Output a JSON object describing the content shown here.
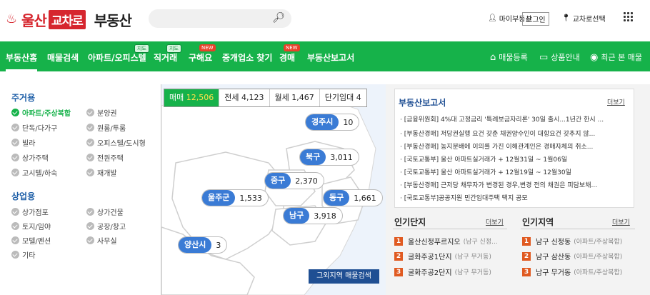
{
  "header": {
    "logo_city": "울산",
    "logo_brand": "교차로",
    "logo_suffix": "부동산",
    "mypage": "마이부동산",
    "login": "로그인",
    "region_select": "교차로선택"
  },
  "nav": {
    "tabs": [
      {
        "label": "부동산홈"
      },
      {
        "label": "매물검색"
      },
      {
        "label": "아파트/오피스텔",
        "badge": "지도"
      },
      {
        "label": "직거래",
        "badge": "지도"
      },
      {
        "label": "구해요",
        "badge": "NEW"
      },
      {
        "label": "중개업소 찾기"
      },
      {
        "label": "경매",
        "badge": "NEW"
      },
      {
        "label": "부동산보고서"
      }
    ],
    "right": [
      {
        "icon": "home-icon",
        "label": "매물등록"
      },
      {
        "icon": "monitor-icon",
        "label": "상품안내"
      },
      {
        "icon": "eye-icon",
        "label": "최근 본 매물"
      }
    ]
  },
  "filters": {
    "residential_title": "주거용",
    "residential": [
      "아파트/주상복합",
      "분양권",
      "단독/다가구",
      "원룸/투룸",
      "빌라",
      "오피스텔/도시형",
      "상가주택",
      "전원주택",
      "고시텔/하숙",
      "재개발"
    ],
    "commercial_title": "상업용",
    "commercial": [
      "상가점포",
      "상가건물",
      "토지/임야",
      "공장/창고",
      "모텔/펜션",
      "사무실",
      "기타"
    ]
  },
  "map": {
    "deal_types": [
      {
        "label": "매매",
        "count": "12,506",
        "selected": true
      },
      {
        "label": "전세",
        "count": "4,123"
      },
      {
        "label": "월세",
        "count": "1,467"
      },
      {
        "label": "단기임대",
        "count": "4"
      }
    ],
    "regions": [
      {
        "name": "경주시",
        "count": "10"
      },
      {
        "name": "북구",
        "count": "3,011"
      },
      {
        "name": "중구",
        "count": "2,370"
      },
      {
        "name": "울주군",
        "count": "1,533"
      },
      {
        "name": "동구",
        "count": "1,661"
      },
      {
        "name": "남구",
        "count": "3,918"
      },
      {
        "name": "양산시",
        "count": "3"
      }
    ],
    "outside_button": "그외지역 매물검색"
  },
  "report": {
    "title": "부동산보고서",
    "more": "더보기",
    "items": [
      "[금융위원회] 4%대 고정금리 '특례보금자리론' 30일 출시...1년간 한시 ...",
      "[부동산경매] 저당권실행 요건 갖춘 채권양수인이 대항요건 갖추지 않...",
      "[부동산경매] 농지분배에 이의를 가진 이해관계인은 경매자체의 취소...",
      "[국토교통부] 울산 아파트실거래가 + 12월31일 ~ 1월06일",
      "[국토교통부] 울산 아파트실거래가 + 12월19일 ~ 12월30일",
      "[부동산경매] 근저당 채무자가 변경된 경우,변경 전의 채권은 피담보채...",
      "[국토교통부]공공지원 민간임대주택 택지 공모"
    ]
  },
  "popular_complex": {
    "title": "인기단지",
    "more": "더보기",
    "items": [
      {
        "rank": "1",
        "name": "울산신정푸르지오",
        "sub": "(남구 신정..."
      },
      {
        "rank": "2",
        "name": "굴화주공1단지",
        "sub": "(남구 무거동)"
      },
      {
        "rank": "3",
        "name": "굴화주공2단지",
        "sub": "(남구 무거동)"
      }
    ]
  },
  "popular_region": {
    "title": "인기지역",
    "more": "더보기",
    "items": [
      {
        "rank": "1",
        "name": "남구 신정동",
        "sub": "(아파트/주상복합)"
      },
      {
        "rank": "2",
        "name": "남구 삼산동",
        "sub": "(아파트/주상복합)"
      },
      {
        "rank": "3",
        "name": "남구 무거동",
        "sub": "(아파트/주상복합)"
      }
    ]
  },
  "colors": {
    "brand_red": "#d6262e",
    "nav_green": "#16b24a",
    "pin_blue": "#3a7bd5",
    "rank_orange": "#e05a21",
    "report_navy": "#1f4f93"
  }
}
